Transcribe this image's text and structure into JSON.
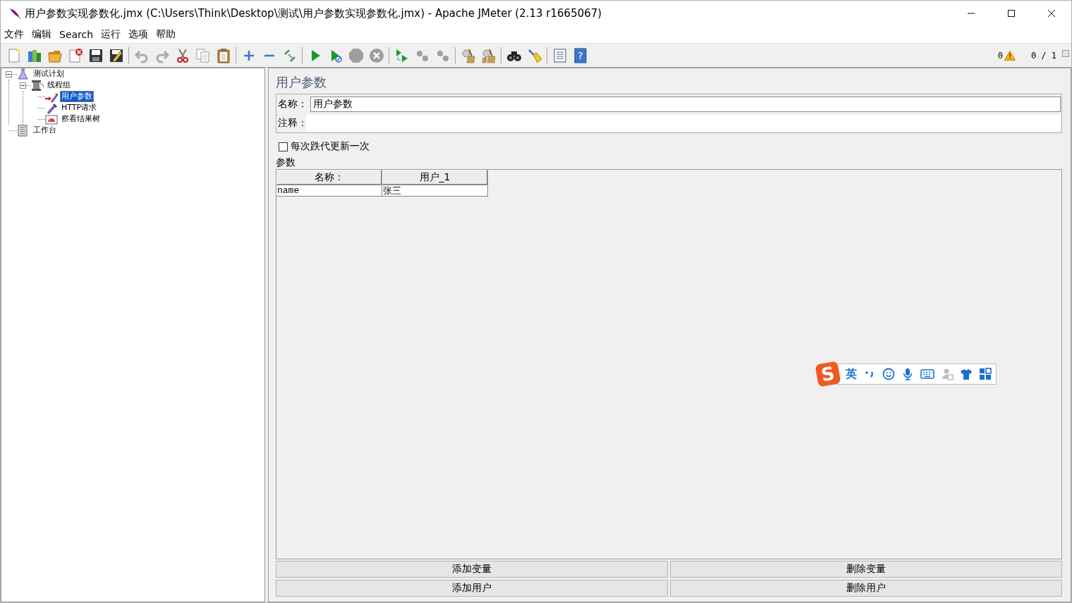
{
  "window": {
    "title": "用户参数实现参数化.jmx (C:\\Users\\Think\\Desktop\\测试\\用户参数实现参数化.jmx) - Apache JMeter (2.13 r1665067)"
  },
  "menu": [
    "文件",
    "编辑",
    "Search",
    "运行",
    "选项",
    "帮助"
  ],
  "toolbar": {
    "groups": [
      {
        "items": [
          {
            "kind": "new",
            "disabled": false
          },
          {
            "kind": "templates",
            "disabled": false
          },
          {
            "kind": "open",
            "disabled": false
          },
          {
            "kind": "close",
            "disabled": false
          },
          {
            "kind": "save",
            "disabled": false
          },
          {
            "kind": "save_as",
            "disabled": false
          }
        ]
      },
      {
        "items": [
          {
            "kind": "undo",
            "disabled": true
          },
          {
            "kind": "redo",
            "disabled": true
          },
          {
            "kind": "cut",
            "disabled": false
          },
          {
            "kind": "copy",
            "disabled": false
          },
          {
            "kind": "paste",
            "disabled": false
          }
        ]
      },
      {
        "items": [
          {
            "kind": "expand",
            "disabled": false
          },
          {
            "kind": "collapse",
            "disabled": false
          },
          {
            "kind": "toggle",
            "disabled": false
          }
        ]
      },
      {
        "items": [
          {
            "kind": "start",
            "disabled": false
          },
          {
            "kind": "start_no_pause",
            "disabled": false
          },
          {
            "kind": "stop",
            "disabled": true
          },
          {
            "kind": "shutdown",
            "disabled": true
          }
        ]
      },
      {
        "items": [
          {
            "kind": "remote_start",
            "disabled": false
          },
          {
            "kind": "remote_stop",
            "disabled": true
          },
          {
            "kind": "remote_shutdown",
            "disabled": true
          }
        ]
      },
      {
        "items": [
          {
            "kind": "clear",
            "disabled": false
          },
          {
            "kind": "clear_all",
            "disabled": false
          }
        ]
      },
      {
        "items": [
          {
            "kind": "search",
            "disabled": false
          },
          {
            "kind": "reset_search",
            "disabled": false
          }
        ]
      },
      {
        "items": [
          {
            "kind": "function_helper",
            "disabled": false
          },
          {
            "kind": "help",
            "disabled": false,
            "glyph": "?"
          }
        ]
      }
    ],
    "status": {
      "warnings": "0",
      "threads": "0 / 1"
    }
  },
  "tree": [
    {
      "label": "测试计划",
      "kind": "plan",
      "expanded": true,
      "selected": false,
      "children": [
        {
          "label": "线程组",
          "kind": "group",
          "expanded": true,
          "selected": false,
          "children": [
            {
              "label": "用户参数",
              "kind": "config",
              "selected": true
            },
            {
              "label": "HTTP请求",
              "kind": "sampler",
              "selected": false
            },
            {
              "label": "察看结果树",
              "kind": "listener",
              "selected": false
            }
          ]
        }
      ]
    },
    {
      "label": "工作台",
      "kind": "workbench",
      "selected": false
    }
  ],
  "editor": {
    "title": "用户参数",
    "name_label": "名称：",
    "name_value": "用户参数",
    "comment_label": "注释：",
    "per_iteration": {
      "label": "每次跌代更新一次",
      "checked": false
    },
    "params_label": "参数",
    "table": {
      "columns": [
        "名称：",
        "用户_1"
      ],
      "rows": [
        [
          "name",
          "张三"
        ]
      ]
    },
    "buttons": [
      "添加变量",
      "删除变量",
      "添加用户",
      "删除用户"
    ]
  },
  "ime_bar": {
    "logo": "S",
    "mode": "英"
  }
}
